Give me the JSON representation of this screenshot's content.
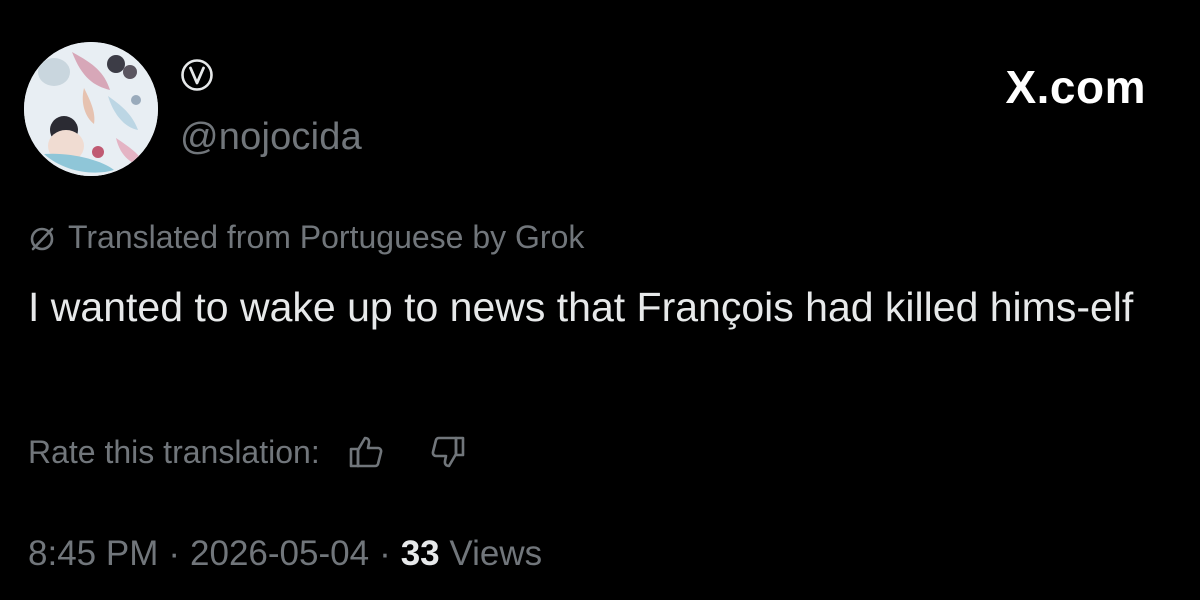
{
  "brand": {
    "label": "X.com"
  },
  "author": {
    "handle": "@nojocida",
    "avatar_icon": "profile-photo",
    "badge_icon": "circled-v-badge"
  },
  "translation": {
    "notice": "Translated from Portuguese by Grok",
    "notice_icon": "slashed-circle-icon",
    "rate_label": "Rate this translation:",
    "rate_up_icon": "thumbs-up-icon",
    "rate_down_icon": "thumbs-down-icon"
  },
  "tweet": {
    "text": "I wanted to wake up to news that François had killed hims-elf"
  },
  "meta": {
    "time": "8:45 PM",
    "separator": "·",
    "date": "2026-05-04",
    "views_count": "33",
    "views_label": "Views"
  },
  "colors": {
    "background": "#000000",
    "primary_text": "#e7e9ea",
    "secondary_text": "#71767b",
    "brand": "#ffffff"
  }
}
